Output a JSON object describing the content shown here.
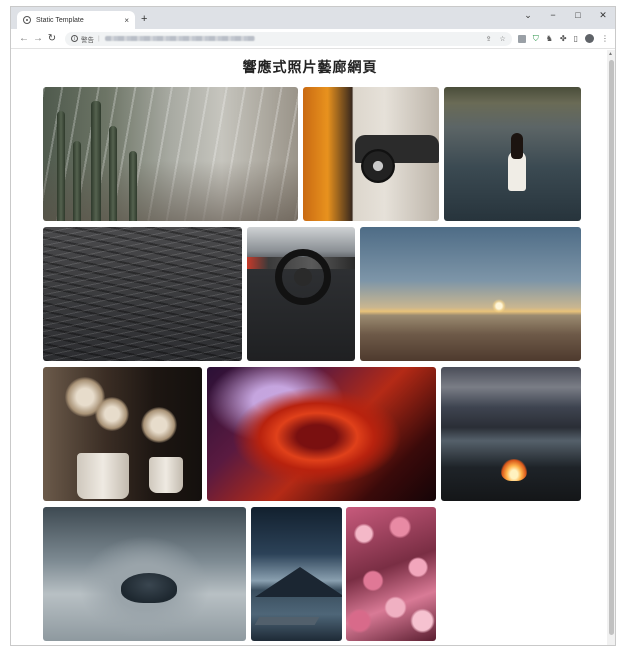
{
  "browser": {
    "tab_title": "Static Template",
    "tab_close": "×",
    "new_tab": "+",
    "omnibox_security": "警告",
    "window_controls": [
      "⌄",
      "−",
      "□",
      "✕"
    ]
  },
  "page": {
    "title": "響應式照片藝廊網頁"
  },
  "gallery": {
    "photos": [
      {
        "subject": "greenhouse with cacti"
      },
      {
        "subject": "orange sports car and black car"
      },
      {
        "subject": "woman wading in lake"
      },
      {
        "subject": "dark water waves"
      },
      {
        "subject": "car steering wheel interior"
      },
      {
        "subject": "desert sunset over mountains"
      },
      {
        "subject": "dried flowers in white vases"
      },
      {
        "subject": "abstract red swirl"
      },
      {
        "subject": "campfire by lake at dusk"
      },
      {
        "subject": "island above clouds"
      },
      {
        "subject": "dock on mountain lake"
      },
      {
        "subject": "pink blossoms"
      }
    ]
  }
}
